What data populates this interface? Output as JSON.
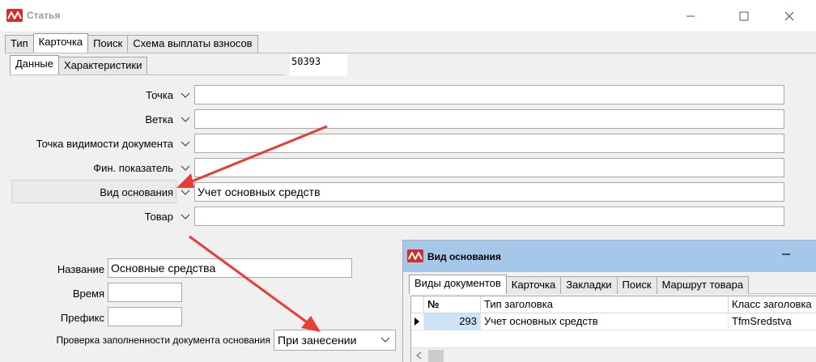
{
  "window": {
    "title": "Статья",
    "min_icon": "minimize-icon",
    "max_icon": "maximize-icon",
    "close_icon": "close-icon"
  },
  "main_tabs": [
    "Тип",
    "Карточка",
    "Поиск",
    "Схема выплаты взносов"
  ],
  "main_tab_active": 1,
  "sub_tabs": [
    "Данные",
    "Характеристики"
  ],
  "sub_tab_active": 0,
  "record_id": "50393",
  "form": {
    "rows": [
      {
        "label": "Точка",
        "value": ""
      },
      {
        "label": "Ветка",
        "value": ""
      },
      {
        "label": "Точка видимости документа",
        "value": ""
      },
      {
        "label": "Фин. показатель",
        "value": ""
      },
      {
        "label": "Вид основания",
        "value": "Учет основных средств"
      },
      {
        "label": "Товар",
        "value": ""
      }
    ],
    "name_label": "Название",
    "name_value": "Основные средства",
    "time_label": "Время",
    "time_value": "",
    "prefix_label": "Префикс",
    "prefix_value": "",
    "check_label": "Проверка заполненности документа основания",
    "check_value": "При занесении"
  },
  "popup": {
    "title": "Вид основания",
    "min_icon": "minimize-icon",
    "tabs": [
      "Виды документов",
      "Карточка",
      "Закладки",
      "Поиск",
      "Маршрут товара"
    ],
    "tab_active": 0,
    "columns": [
      "№",
      "Тип заголовка",
      "Класс заголовка"
    ],
    "rows": [
      {
        "num": "293",
        "type": "Учет основных средств",
        "class": "TfmSredstva"
      }
    ]
  },
  "colors": {
    "accent_red": "#d42d28",
    "popup_title": "#a5c8ea",
    "arrow": "#e53e34",
    "selected_cell": "#cfe3f7"
  }
}
